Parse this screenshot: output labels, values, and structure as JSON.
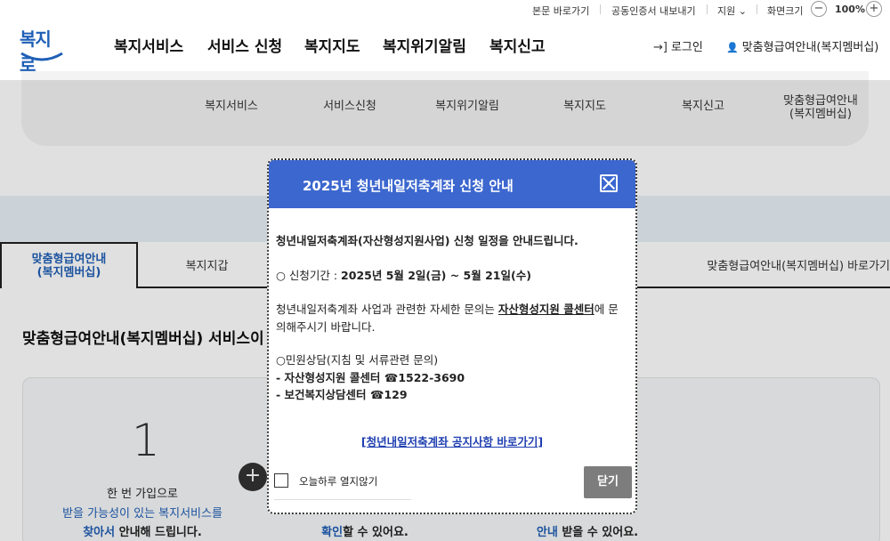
{
  "util": {
    "skip": "본문 바로가기",
    "cert": "공동인증서 내보내기",
    "lang": "지원",
    "lang_arrow": "⌄",
    "screen": "화면크기",
    "zoom": "100%",
    "minus": "−",
    "plus": "+"
  },
  "header": {
    "logo_text": "복지로",
    "gnb": [
      "복지서비스",
      "서비스 신청",
      "복지지도",
      "복지위기알림",
      "복지신고"
    ],
    "login": "로그인",
    "member": "맞춤형급여안내(복지멤버십)",
    "login_icon": "→]",
    "member_icon": "👤"
  },
  "submenu": {
    "items": [
      "복지서비스",
      "서비스신청",
      "복지위기알림",
      "복지지도",
      "복지신고",
      "맞춤형급여안내\n(복지멤버십)"
    ]
  },
  "tabs": {
    "active": "맞춤형급여안내\n(복지멤버십)",
    "second": "복지지갑",
    "right": "맞춤형급여안내(복지멤버십) 바로가기"
  },
  "section": {
    "title": "맞춤형급여안내(복지멤버십) 서비스이",
    "num": "1",
    "line1": "한 번 가입으로",
    "line2": "받을 가능성이 있는 복지서비스를",
    "line3a": "찾아서",
    "line3b": " 안내해 드립니다.",
    "mid_bottom_a": "확인",
    "mid_bottom_b": "할 수 있어요.",
    "right_bottom_a": "안내",
    "right_bottom_b": " 받을 수 있어요.",
    "plus": "+"
  },
  "modal": {
    "title": "2025년 청년내일저축계좌 신청 안내",
    "intro": "청년내일저축계좌(자산형성지원사업) 신청 일정을 안내드립니다.",
    "period_label": "○ 신청기간 : ",
    "period_value": "2025년 5월 2일(금) ~ 5월 21일(수)",
    "info1a": "청년내일저축계좌 사업과 관련한 자세한 문의는 ",
    "info1b": "자산형성지원 콜센터",
    "info1c": "에 문",
    "info2": "의해주시기 바랍니다.",
    "consult": "○민원상담(지침 및 서류관련 문의)",
    "call1": " - 자산형성지원 콜센터 ☎1522-3690",
    "call2": " - 보건복지상담센터 ☎129",
    "notice_link": "[청년내일저축계좌 공지사항 바로가기]",
    "checkbox_label": "오늘하루 열지않기",
    "close_label": "닫기"
  },
  "colors": {
    "modal_header": "#3c67cf",
    "brand": "#1f5fb6",
    "close_btn": "#7d7d7d"
  }
}
